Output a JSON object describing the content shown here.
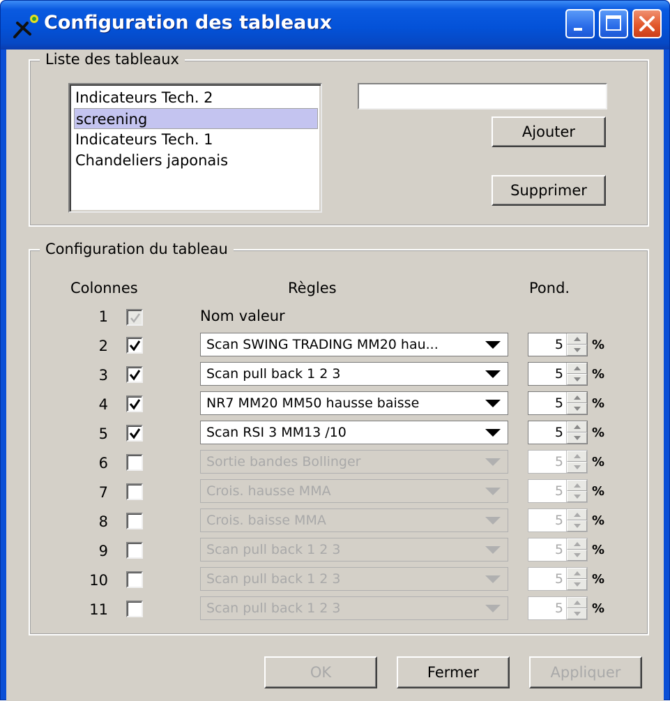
{
  "window": {
    "title": "Configuration des tableaux",
    "controls": [
      "minimize-icon",
      "maximize-icon",
      "close-icon"
    ],
    "colors": {
      "titlebar": "#0452d8",
      "close": "#e2582c",
      "face": "#d4d0c8"
    }
  },
  "list_group": {
    "title": "Liste des tableaux",
    "items": [
      "Indicateurs Tech. 2",
      "screening",
      "Indicateurs Tech. 1",
      "Chandeliers japonais"
    ],
    "selected": "screening",
    "name_input_value": "",
    "add_label": "Ajouter",
    "delete_label": "Supprimer"
  },
  "config_group": {
    "title": "Configuration du tableau",
    "headers": {
      "columns": "Colonnes",
      "rules": "Règles",
      "weight": "Pond."
    },
    "first_row": {
      "num": "1",
      "label": "Nom valeur",
      "checked": true,
      "enabled": false
    },
    "percent_sign": "%",
    "rows": [
      {
        "num": "2",
        "checked": true,
        "enabled": true,
        "rule": "Scan SWING TRADING MM20 hau...",
        "weight": "5"
      },
      {
        "num": "3",
        "checked": true,
        "enabled": true,
        "rule": " Scan pull back 1 2 3",
        "weight": "5"
      },
      {
        "num": "4",
        "checked": true,
        "enabled": true,
        "rule": "NR7 MM20 MM50 hausse baisse",
        "weight": "5"
      },
      {
        "num": "5",
        "checked": true,
        "enabled": true,
        "rule": "Scan RSI 3 MM13 /10",
        "weight": "5"
      },
      {
        "num": "6",
        "checked": false,
        "enabled": false,
        "rule": "Sortie bandes Bollinger",
        "weight": "5"
      },
      {
        "num": "7",
        "checked": false,
        "enabled": false,
        "rule": "Crois. hausse MMA",
        "weight": "5"
      },
      {
        "num": "8",
        "checked": false,
        "enabled": false,
        "rule": "Crois. baisse MMA",
        "weight": "5"
      },
      {
        "num": "9",
        "checked": false,
        "enabled": false,
        "rule": " Scan pull back 1 2 3",
        "weight": "5"
      },
      {
        "num": "10",
        "checked": false,
        "enabled": false,
        "rule": " Scan pull back 1 2 3",
        "weight": "5"
      },
      {
        "num": "11",
        "checked": false,
        "enabled": false,
        "rule": " Scan pull back 1 2 3",
        "weight": "5"
      }
    ]
  },
  "footer": {
    "ok_label": "OK",
    "close_label": "Fermer",
    "apply_label": "Appliquer"
  }
}
